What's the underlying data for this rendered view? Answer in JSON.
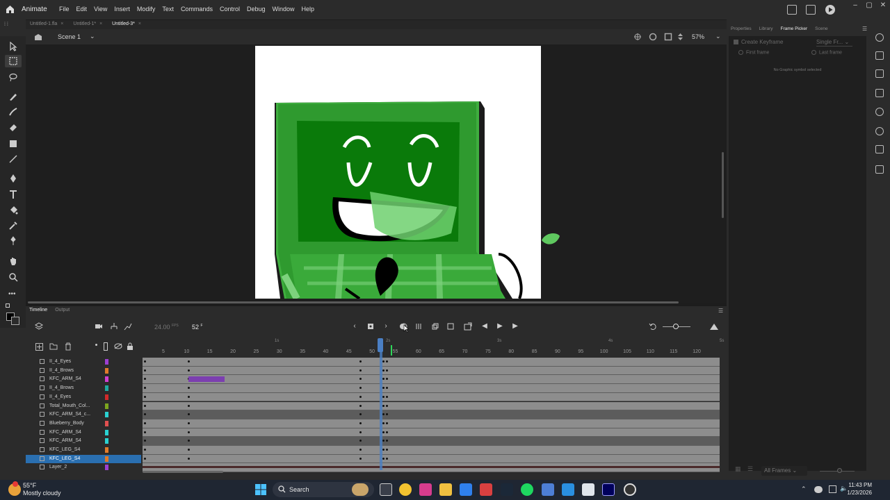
{
  "app": {
    "name": "Animate"
  },
  "menus": [
    "File",
    "Edit",
    "View",
    "Insert",
    "Modify",
    "Text",
    "Commands",
    "Control",
    "Debug",
    "Window",
    "Help"
  ],
  "doc_tabs": [
    {
      "label": "Untitled-1.fla",
      "active": false
    },
    {
      "label": "Untitled-1*",
      "active": false
    },
    {
      "label": "Untitled-3*",
      "active": true
    }
  ],
  "scene": {
    "label": "Scene 1",
    "zoom": "57%"
  },
  "timeline": {
    "tabs": [
      {
        "label": "Timeline",
        "active": true
      },
      {
        "label": "Output",
        "active": false
      }
    ],
    "fps": "24.00",
    "fps_unit": "FPS",
    "current_frame": "52",
    "frame_unit": "F",
    "seconds": [
      "1s",
      "2s",
      "3s",
      "4s",
      "5s"
    ],
    "ticks": [
      "5",
      "10",
      "15",
      "20",
      "25",
      "30",
      "35",
      "40",
      "45",
      "50",
      "55",
      "60",
      "65",
      "70",
      "75",
      "80",
      "85",
      "90",
      "95",
      "100",
      "105",
      "110",
      "115",
      "120"
    ],
    "layers": [
      {
        "name": "II_4_Eyes",
        "color": "#9b3fd1"
      },
      {
        "name": "II_4_Brows",
        "color": "#e07b2a"
      },
      {
        "name": "KFC_ARM_S4",
        "color": "#d13fd1"
      },
      {
        "name": "II_4_Brows",
        "color": "#1fa9a0"
      },
      {
        "name": "II_4_Eyes",
        "color": "#d12a2a"
      },
      {
        "name": "Total_Mouth_Col...",
        "color": "#7ca51f"
      },
      {
        "name": "KFC_ARM_S4_c...",
        "color": "#2ad1d1"
      },
      {
        "name": "Blueberry_Body",
        "color": "#e05050"
      },
      {
        "name": "KFC_ARM_S4",
        "color": "#2ad1d1"
      },
      {
        "name": "KFC_ARM_S4",
        "color": "#2ad1d1"
      },
      {
        "name": "KFC_LEG_S4",
        "color": "#e07b2a"
      },
      {
        "name": "KFC_LEG_S4",
        "color": "#e07b2a",
        "selected": true
      },
      {
        "name": "Layer_2",
        "color": "#9b3fd1"
      }
    ]
  },
  "right_panel": {
    "tabs": [
      {
        "label": "Properties",
        "active": false
      },
      {
        "label": "Library",
        "active": false
      },
      {
        "label": "Frame Picker",
        "active": true
      },
      {
        "label": "Scene",
        "active": false
      }
    ],
    "create_keyframe": "Create Keyframe",
    "mode": "Single Fr...",
    "first_frame": "First frame",
    "last_frame": "Last frame",
    "empty_message": "No Graphic symbol selected",
    "filter": "All Frames"
  },
  "taskbar": {
    "weather_temp": "55°F",
    "weather_desc": "Mostly cloudy",
    "search_label": "Search",
    "time": "11:43 PM",
    "date": "1/23/2026"
  }
}
